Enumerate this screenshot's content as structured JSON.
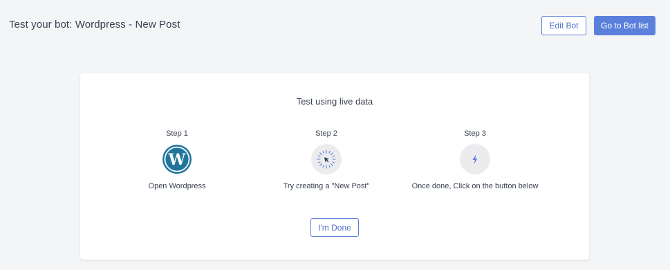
{
  "header": {
    "title": "Test your bot: Wordpress - New Post",
    "edit_bot_label": "Edit Bot",
    "bot_list_label": "Go to Bot list"
  },
  "card": {
    "title": "Test using live data",
    "steps": [
      {
        "label": "Step 1",
        "icon": "wordpress-logo-icon",
        "description": "Open Wordpress"
      },
      {
        "label": "Step 2",
        "icon": "cursor-click-icon",
        "description": "Try creating a \"New Post\""
      },
      {
        "label": "Step 3",
        "icon": "lightning-bolt-icon",
        "description": "Once done, Click on the button below"
      }
    ],
    "done_label": "I'm Done"
  },
  "colors": {
    "accent": "#5b80dc",
    "background": "#f4f5f7",
    "wordpress_blue": "#21759b"
  }
}
